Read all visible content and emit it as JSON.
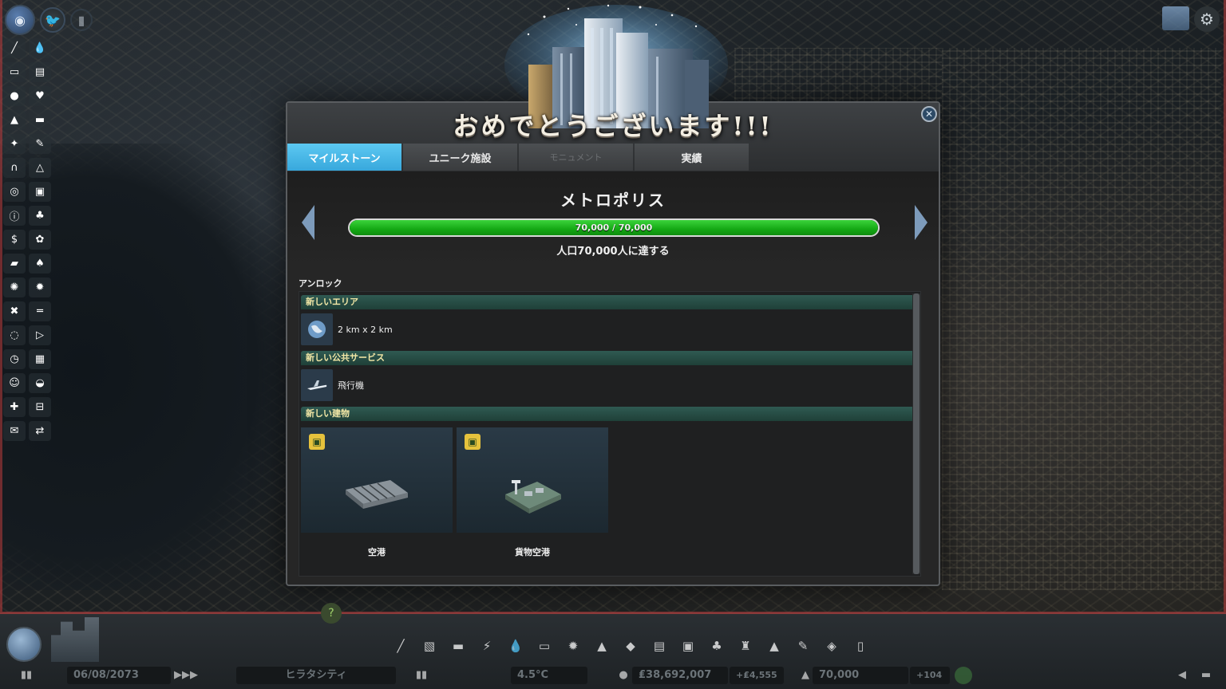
{
  "dialog": {
    "title": "おめでとうございます!!!",
    "close_glyph": "✕",
    "tabs": [
      {
        "label": "マイルストーン",
        "state": "active"
      },
      {
        "label": "ユニーク施設",
        "state": "normal"
      },
      {
        "label": "モニュメント",
        "state": "disabled"
      },
      {
        "label": "実績",
        "state": "normal"
      }
    ],
    "milestone": {
      "name": "メトロポリス",
      "progress_text": "70,000 / 70,000",
      "progress_fraction": 1.0,
      "description": "人口70,000人に達する"
    },
    "unlock_label": "アンロック",
    "sections": {
      "area": {
        "title": "新しいエリア",
        "item_text": "2 km x 2 km",
        "icon": "globe-icon"
      },
      "service": {
        "title": "新しい公共サービス",
        "item_text": "飛行機",
        "icon": "airplane-icon"
      },
      "buildings": {
        "title": "新しい建物",
        "items": [
          {
            "label": "空港",
            "icon": "bus-badge-icon"
          },
          {
            "label": "貨物空港",
            "icon": "bus-badge-icon"
          }
        ]
      }
    }
  },
  "status_bar": {
    "date": "06/08/2073",
    "play_speed": "▶▶▶",
    "city_name": "ヒラタシティ",
    "temperature": "4.5°C",
    "money": "₤38,692,007",
    "income": "+₤4,555",
    "population": "70,000",
    "population_change": "+104"
  },
  "colors": {
    "tab_active": "#48b8e8",
    "progress_fill": "#14a814",
    "section_title": "#f2e7a6",
    "section_bar": "#2f5a52"
  }
}
